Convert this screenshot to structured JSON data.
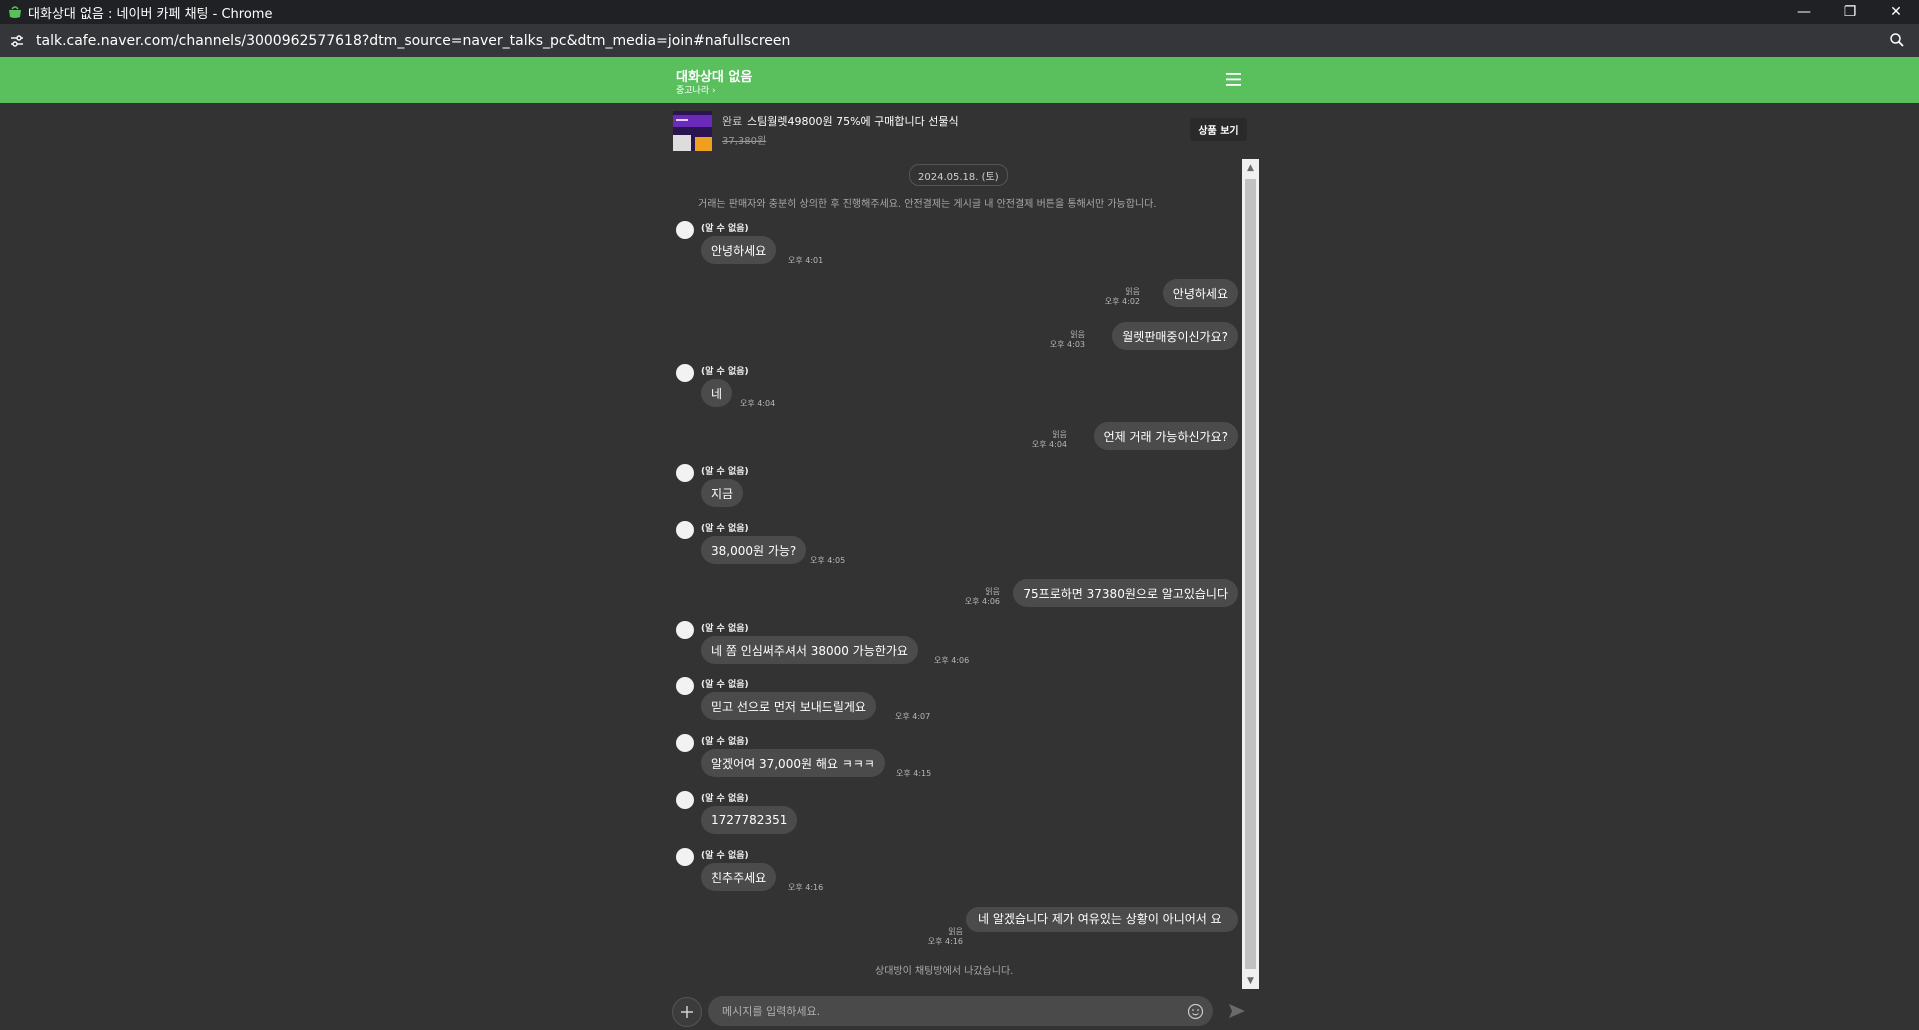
{
  "window": {
    "title": "대화상대 없음 : 네이버 카페 채팅 - Chrome",
    "url": "talk.cafe.naver.com/channels/3000962577618?dtm_source=naver_talks_pc&dtm_media=join#nafullscreen"
  },
  "header": {
    "title": "대화상대 없음",
    "subtitle": "중고나라 ›"
  },
  "product": {
    "status": "완료",
    "name": "스팀월렛49800원 75%에 구매합니다 선물식",
    "price": "37,380원",
    "view_button": "상품 보기"
  },
  "chat": {
    "date": "2024.05.18. (토)",
    "notice": "거래는 판매자와 충분히 상의한 후 진행해주세요. 안전결제는 게시글 내 안전결제 버튼을 통해서만 가능합니다.",
    "read_label": "읽음",
    "unknown_sender": "(알 수 없음)",
    "messages": [
      {
        "side": "in",
        "sender": "(알 수 없음)",
        "text": "안녕하세요",
        "time": "오후 4:01"
      },
      {
        "side": "out",
        "text": "안녕하세요",
        "read": "읽음",
        "time": "오후 4:02"
      },
      {
        "side": "out",
        "text": "월렛판매중이신가요?",
        "read": "읽음",
        "time": "오후 4:03"
      },
      {
        "side": "in",
        "sender": "(알 수 없음)",
        "text": "네",
        "time": "오후 4:04"
      },
      {
        "side": "out",
        "text": "언제 거래 가능하신가요?",
        "read": "읽음",
        "time": "오후 4:04"
      },
      {
        "side": "in",
        "sender": "(알 수 없음)",
        "text": "지금",
        "time": ""
      },
      {
        "side": "in",
        "sender": "(알 수 없음)",
        "text": "38,000원 가능?",
        "time": "오후 4:05"
      },
      {
        "side": "out",
        "text": "75프로하면 37380원으로 알고있습니다",
        "read": "읽음",
        "time": "오후 4:06"
      },
      {
        "side": "in",
        "sender": "(알 수 없음)",
        "text": "네  쫌 인심써주셔서 38000 가능한가요",
        "time": "오후 4:06"
      },
      {
        "side": "in",
        "sender": "(알 수 없음)",
        "text": "믿고 선으로 먼저 보내드릴게요",
        "time": "오후 4:07"
      },
      {
        "side": "in",
        "sender": "(알 수 없음)",
        "text": "알겠어여 37,000원 해요 ㅋㅋㅋ",
        "time": "오후 4:15"
      },
      {
        "side": "in",
        "sender": "(알 수 없음)",
        "text": "1727782351",
        "time": ""
      },
      {
        "side": "in",
        "sender": "(알 수 없음)",
        "text": "친추주세요",
        "time": "오후 4:16"
      },
      {
        "side": "out",
        "text": "네 알겠습니다 제가 여유있는 상황이 아니어서 요",
        "read": "읽음",
        "time": "오후 4:16"
      }
    ],
    "left_notice": "상대방이 채팅방에서 나갔습니다."
  },
  "input": {
    "placeholder": "메시지를 입력하세요."
  },
  "colors": {
    "header_green": "#5ac05d",
    "background": "#333333",
    "bubble": "#4b4b4b"
  }
}
